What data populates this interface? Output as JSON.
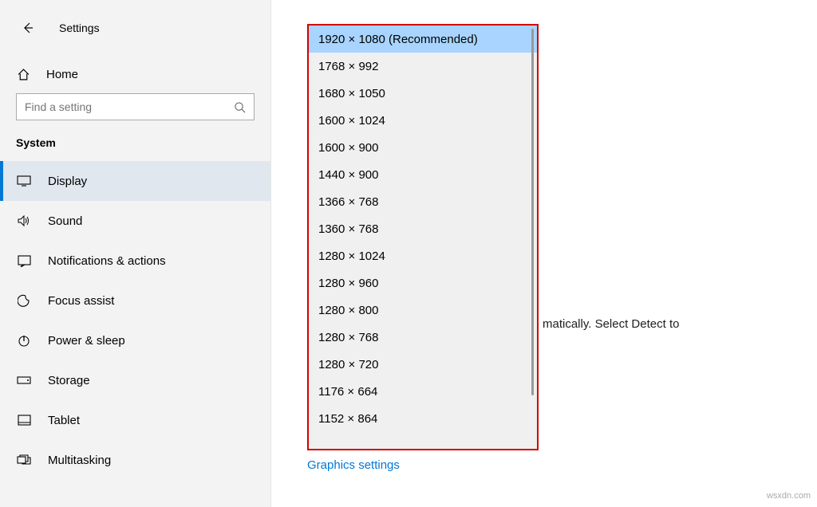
{
  "header": {
    "title": "Settings"
  },
  "home": {
    "label": "Home"
  },
  "search": {
    "placeholder": "Find a setting"
  },
  "section": "System",
  "nav": [
    {
      "label": "Display",
      "active": true
    },
    {
      "label": "Sound"
    },
    {
      "label": "Notifications & actions"
    },
    {
      "label": "Focus assist"
    },
    {
      "label": "Power & sleep"
    },
    {
      "label": "Storage"
    },
    {
      "label": "Tablet"
    },
    {
      "label": "Multitasking"
    }
  ],
  "resolutions": [
    "1920 × 1080 (Recommended)",
    "1768 × 992",
    "1680 × 1050",
    "1600 × 1024",
    "1600 × 900",
    "1440 × 900",
    "1366 × 768",
    "1360 × 768",
    "1280 × 1024",
    "1280 × 960",
    "1280 × 800",
    "1280 × 768",
    "1280 × 720",
    "1176 × 664",
    "1152 × 864"
  ],
  "partial_text": "matically. Select Detect to",
  "graphics_link": "Graphics settings",
  "watermark": "wsxdn.com"
}
